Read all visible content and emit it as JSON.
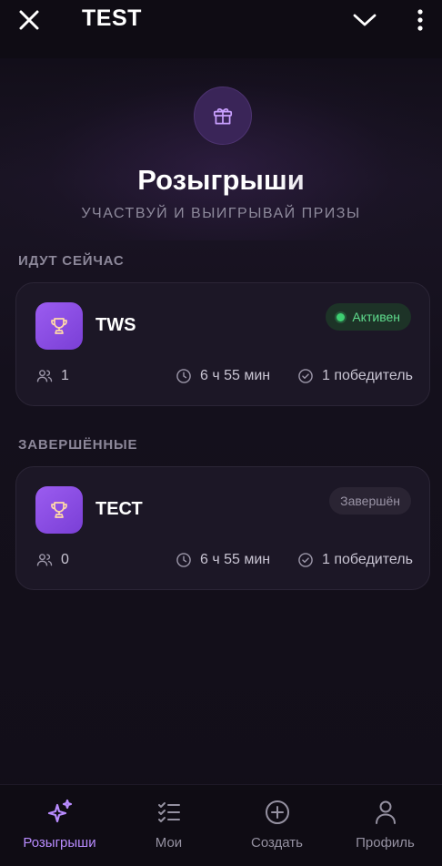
{
  "header": {
    "title": "TEST"
  },
  "hero": {
    "title": "Розыгрыши",
    "subtitle": "УЧАСТВУЙ И ВЫИГРЫВАЙ ПРИЗЫ",
    "icon": "gift-icon"
  },
  "sections": {
    "active_label": "ИДУТ СЕЙЧАС",
    "finished_label": "ЗАВЕРШЁННЫЕ"
  },
  "active_card": {
    "name": "TWS",
    "status": "Активен",
    "participants": "1",
    "time_left": "6 ч 55 мин",
    "winners": "1 победитель"
  },
  "finished_card": {
    "name": "ТЕСТ",
    "status": "Завершён",
    "participants": "0",
    "time_left": "6 ч 55 мин",
    "winners": "1 победитель"
  },
  "nav": {
    "items": [
      {
        "label": "Розыгрыши",
        "icon": "sparkles-icon",
        "active": true
      },
      {
        "label": "Мои",
        "icon": "checklist-icon",
        "active": false
      },
      {
        "label": "Создать",
        "icon": "plus-circle-icon",
        "active": false
      },
      {
        "label": "Профиль",
        "icon": "user-icon",
        "active": false
      }
    ]
  },
  "colors": {
    "accent": "#9b5cf0",
    "active_green": "#3ecf72",
    "background": "#100c17",
    "card": "#1c1726"
  }
}
